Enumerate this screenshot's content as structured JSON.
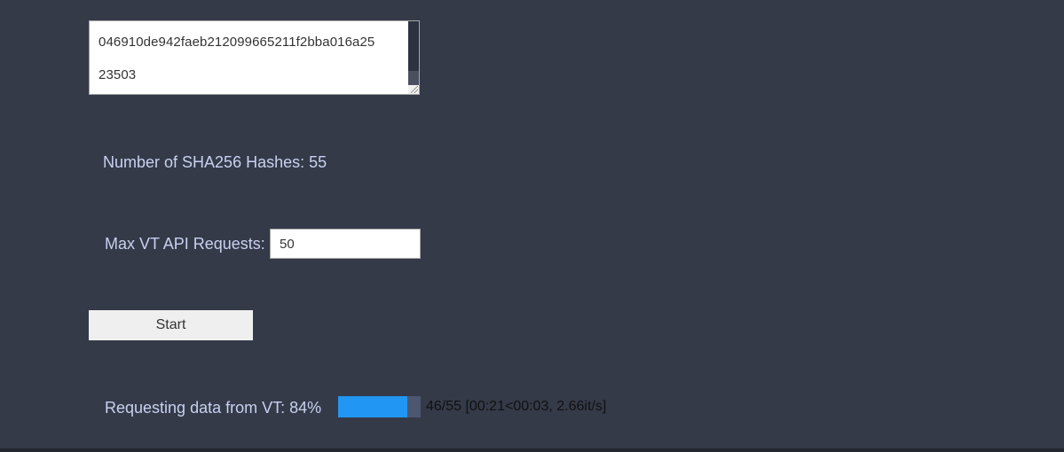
{
  "hashes": {
    "line1": "046910de942faeb212099665211f2bba016a25",
    "line2": "23503"
  },
  "count": {
    "label": "Number of SHA256 Hashes: 55"
  },
  "max_requests": {
    "label": "Max VT API Requests:",
    "value": "50"
  },
  "start": {
    "label": "Start"
  },
  "progress": {
    "label": "Requesting data from VT: 84%",
    "fraction": 0.84,
    "stats": "46/55 [00:21<00:03, 2.66it/s]",
    "bar_color": "#2196f3",
    "track_color": "#4e5770"
  },
  "colors": {
    "background": "#343a48",
    "label_text": "#c8d1f0"
  }
}
